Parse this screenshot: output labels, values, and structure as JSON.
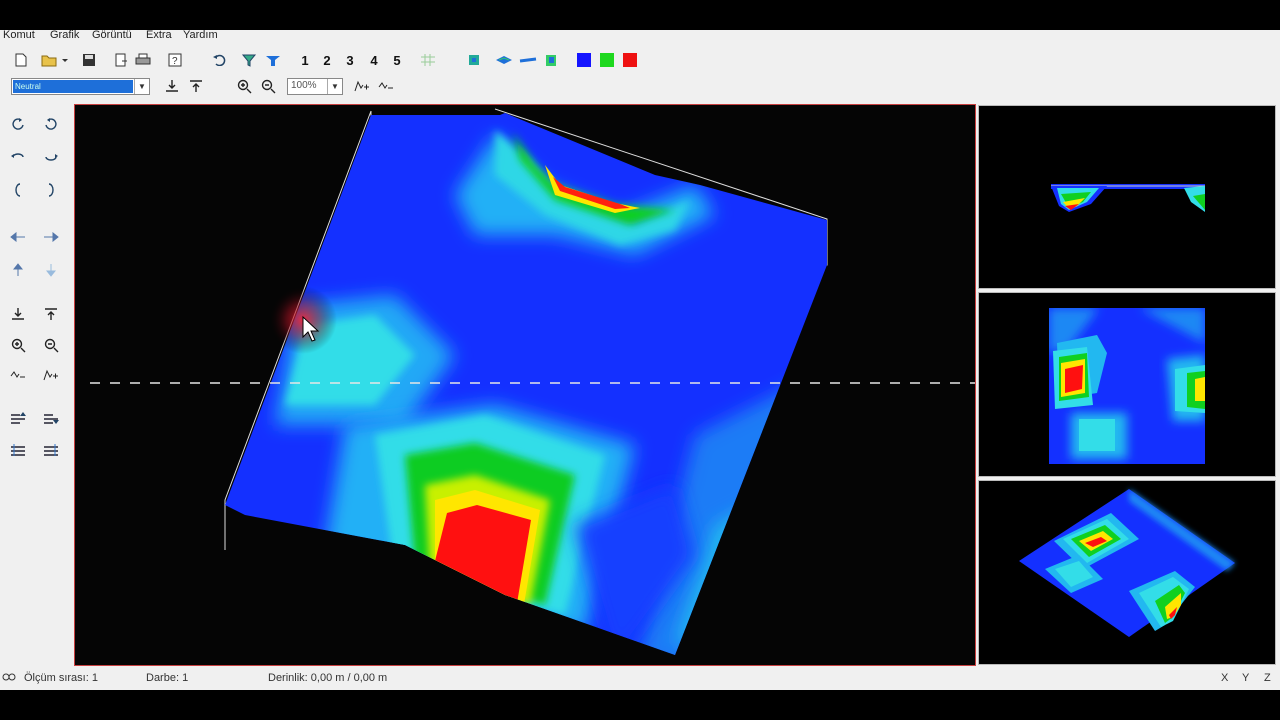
{
  "menu": [
    "Komut",
    "Grafik",
    "Görüntü",
    "Extra",
    "Yardım"
  ],
  "toolbar": {
    "view_buttons": [
      "1",
      "2",
      "3",
      "4",
      "5"
    ],
    "color_swatches": [
      "#1414ff",
      "#1ed81e",
      "#ee1111"
    ],
    "mode_select_value": "Neutral",
    "zoom_select_value": "100%"
  },
  "status": {
    "measure_order": "Ölçüm sırası: 1",
    "pulse": "Darbe: 1",
    "depth": "Derinlik: 0,00 m / 0,00 m",
    "axes": [
      "X",
      "Y",
      "Z"
    ]
  },
  "colors": {
    "accent_border": "#c84040",
    "scan_low": "#1430ff",
    "scan_mid": "#00e5e5",
    "scan_green": "#00d010",
    "scan_yellow": "#ffea00",
    "scan_high": "#ff0000"
  },
  "icons": {
    "left_toolbar": [
      "rotate-left-icon",
      "rotate-right-icon",
      "tilt-left-icon",
      "tilt-right-icon",
      "roll-left-icon",
      "roll-right-icon",
      "move-left-icon",
      "move-right-icon",
      "move-up-icon",
      "move-down-icon",
      "depth-down-icon",
      "depth-up-icon",
      "zoom-in-icon",
      "zoom-out-icon",
      "marker-remove-icon",
      "marker-add-icon",
      "layer-up-icon",
      "layer-down-icon",
      "layer-prev-icon",
      "layer-next-icon"
    ]
  }
}
